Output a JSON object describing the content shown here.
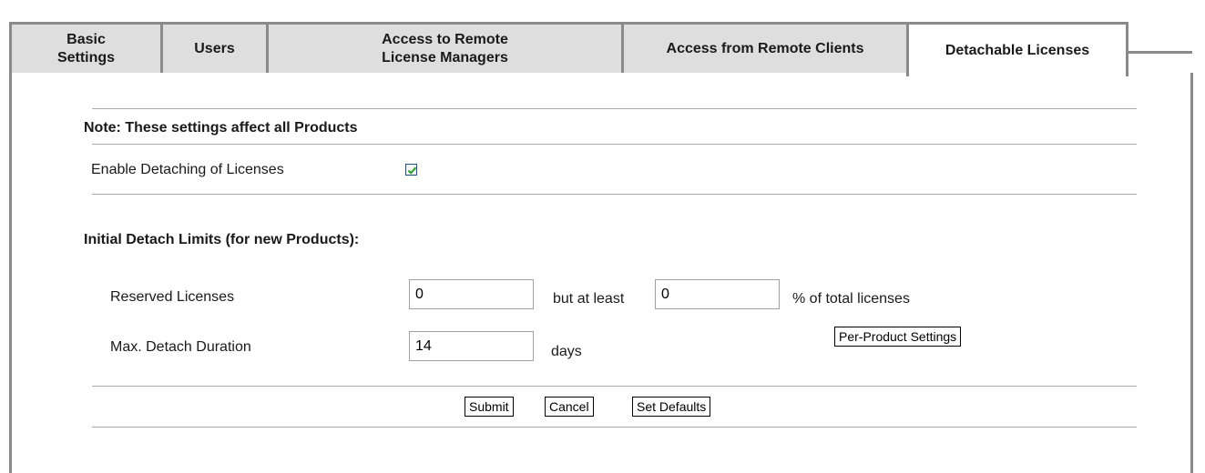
{
  "tabs": [
    {
      "label": "Basic\nSettings"
    },
    {
      "label": "Users"
    },
    {
      "label": "Access to Remote\nLicense Managers"
    },
    {
      "label": "Access from Remote Clients"
    },
    {
      "label": "Detachable Licenses"
    }
  ],
  "note": "Note: These settings affect all Products",
  "enable_detaching": {
    "label": "Enable Detaching of Licenses",
    "checked": true
  },
  "initial_limits_heading": "Initial Detach Limits (for new Products):",
  "reserved": {
    "label": "Reserved Licenses",
    "value": "0",
    "but_at_least": "but at least",
    "percent_value": "0",
    "percent_suffix": "% of total licenses"
  },
  "max_duration": {
    "label": "Max. Detach Duration",
    "value": "14",
    "unit": "days"
  },
  "buttons": {
    "per_product": "Per-Product Settings",
    "submit": "Submit",
    "cancel": "Cancel",
    "set_defaults": "Set Defaults"
  },
  "colors": {
    "active_tab": "#ffffff",
    "inactive_tab": "#dedede",
    "border": "#8a8a8a",
    "checkmark": "#2a9d2a"
  }
}
